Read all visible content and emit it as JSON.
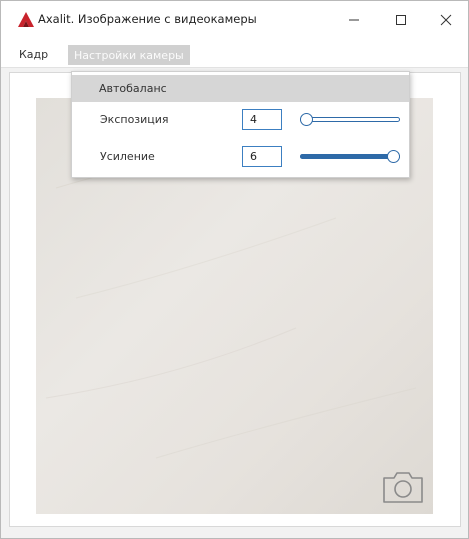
{
  "window": {
    "title": "Axalit. Изображение с видеокамеры",
    "icon": "axalit-logo-icon",
    "controls": {
      "minimize": "—",
      "maximize": "☐",
      "close": "✕"
    }
  },
  "menu": {
    "items": [
      {
        "label": "Кадр"
      },
      {
        "label": "Настройки камеры"
      }
    ]
  },
  "dropdown": {
    "autobalance_label": "Автобаланс",
    "exposure": {
      "label": "Экспозиция",
      "value": "4",
      "slider_fraction": 0.0
    },
    "gain": {
      "label": "Усиление",
      "value": "6",
      "slider_fraction": 1.0
    }
  },
  "camera": {
    "snapshot_icon": "camera-icon"
  },
  "colors": {
    "accent": "#2e6aa8",
    "logo_red": "#c8232c",
    "menu_highlight": "#d0d0d0"
  }
}
